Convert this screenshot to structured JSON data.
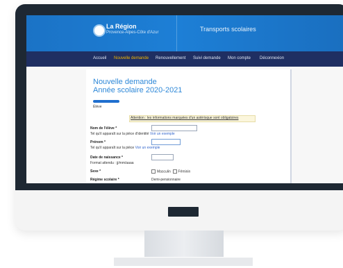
{
  "header": {
    "logo_title": "La Région",
    "logo_sub": "Provence-Alpes-Côte d'Azur",
    "site_title": "Transports scolaires"
  },
  "nav": {
    "items": [
      {
        "label": "Accueil",
        "active": false
      },
      {
        "label": "Nouvelle demande",
        "active": true
      },
      {
        "label": "Renouvellement",
        "active": false
      },
      {
        "label": "Suivi demande",
        "active": false
      },
      {
        "label": "Mon compte",
        "active": false
      },
      {
        "label": "Déconnexion",
        "active": false
      }
    ]
  },
  "form": {
    "title_line1": "Nouvelle demande",
    "title_line2": "Année scolaire 2020-2021",
    "step_label": "Élève",
    "notice": "Attention : les informations marquées d'un astérisque sont obligatoires",
    "fields": {
      "nom_label": "Nom de l'élève *",
      "nom_help": "Tel qu'il apparaît sur la pièce d'identité",
      "nom_help_link": "Voir un exemple",
      "prenom_label": "Prénom *",
      "prenom_help": "Tel qu'il apparaît sur la pièce",
      "prenom_help_link": "Voir un exemple",
      "naissance_label": "Date de naissance *",
      "naissance_help": "Format attendu : jj/mm/aaaa",
      "sexe_label": "Sexe *",
      "sexe_options": [
        "Masculin",
        "Féminin"
      ],
      "regime_label": "Régime scolaire *",
      "regime_value": "Demi-pensionnaire"
    }
  },
  "colors": {
    "header_blue": "#1b73c6",
    "nav_navy": "#1f2f62",
    "active_nav": "#f0b400",
    "heading_blue": "#2e88d8",
    "bezel": "#1e2833"
  }
}
